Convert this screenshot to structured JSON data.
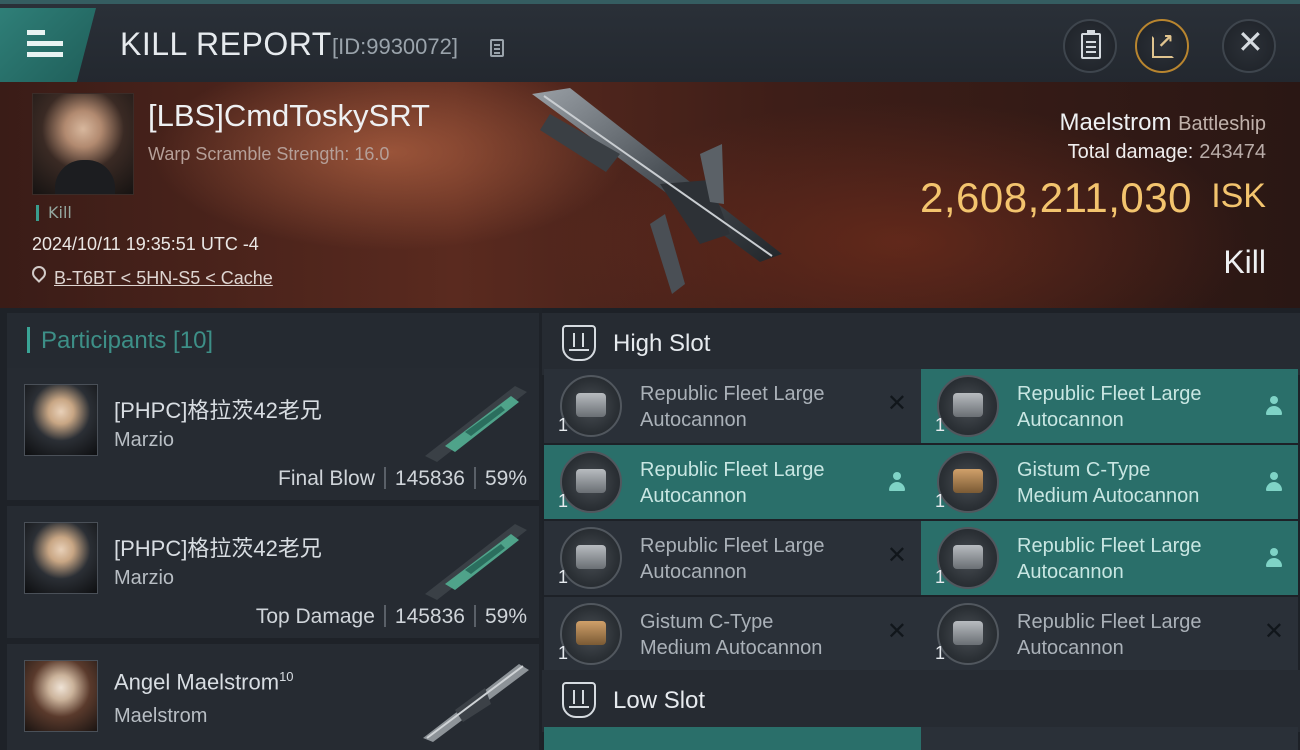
{
  "header": {
    "title": "KILL REPORT",
    "report_id": "[ID:9930072]"
  },
  "victim": {
    "name": "[LBS]CmdToskySRT",
    "warp_scramble": "Warp Scramble Strength: 16.0",
    "tag": "Kill",
    "datetime": "2024/10/11 19:35:51 UTC -4",
    "location": "B-T6BT < 5HN-S5 < Cache",
    "ship_name": "Maelstrom",
    "ship_class": "Battleship",
    "total_damage_label": "Total damage:",
    "total_damage": "243474",
    "isk_value": "2,608,211,030",
    "isk_unit": "ISK",
    "result": "Kill"
  },
  "participants": {
    "title": "Participants [10]",
    "items": [
      {
        "name": "[PHPC]格拉茨42老兄",
        "ship": "Marzio",
        "role": "Final Blow",
        "damage": "145836",
        "percent": "59%"
      },
      {
        "name": "[PHPC]格拉茨42老兄",
        "ship": "Marzio",
        "role": "Top Damage",
        "damage": "145836",
        "percent": "59%"
      },
      {
        "name": "Angel Maelstrom",
        "level": "10",
        "ship": "Maelstrom"
      }
    ]
  },
  "high_slot": {
    "title": "High Slot",
    "items": [
      {
        "name_line1": "Republic Fleet Large",
        "name_line2": "Autocannon",
        "qty": "1",
        "status": "destroyed",
        "icon": "autocannon-icon"
      },
      {
        "name_line1": "Republic Fleet Large",
        "name_line2": "Autocannon",
        "qty": "1",
        "status": "dropped",
        "icon": "autocannon-icon"
      },
      {
        "name_line1": "Republic Fleet Large",
        "name_line2": "Autocannon",
        "qty": "1",
        "status": "dropped",
        "icon": "autocannon-icon"
      },
      {
        "name_line1": "Gistum C-Type",
        "name_line2": "Medium Autocannon",
        "qty": "1",
        "status": "dropped",
        "icon": "autocannon-icon"
      },
      {
        "name_line1": "Republic Fleet Large",
        "name_line2": "Autocannon",
        "qty": "1",
        "status": "destroyed",
        "icon": "autocannon-icon"
      },
      {
        "name_line1": "Republic Fleet Large",
        "name_line2": "Autocannon",
        "qty": "1",
        "status": "dropped",
        "icon": "autocannon-icon"
      },
      {
        "name_line1": "Gistum C-Type",
        "name_line2": "Medium Autocannon",
        "qty": "1",
        "status": "destroyed",
        "icon": "autocannon-icon"
      },
      {
        "name_line1": "Republic Fleet Large",
        "name_line2": "Autocannon",
        "qty": "1",
        "status": "destroyed",
        "icon": "autocannon-icon"
      }
    ]
  },
  "low_slot": {
    "title": "Low Slot"
  },
  "colors": {
    "accent": "#2a6f6a",
    "isk": "#f3c46e",
    "dropped_icon": "#7fd3c6"
  }
}
